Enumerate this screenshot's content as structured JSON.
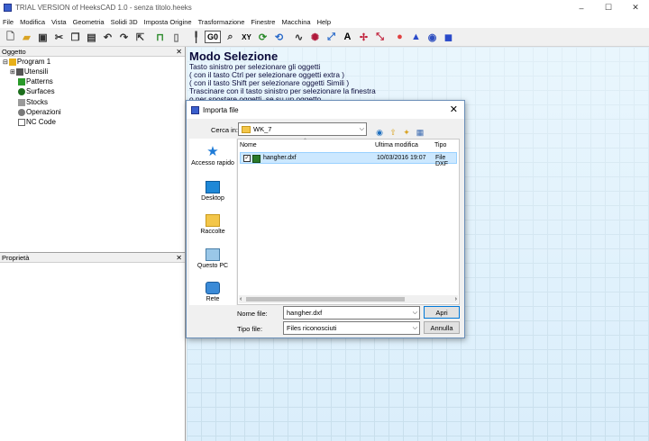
{
  "window": {
    "title": "TRIAL VERSION of HeeksCAD 1.0 - senza titolo.heeks",
    "minimize": "–",
    "maximize": "☐",
    "close": "✕"
  },
  "menu": [
    "File",
    "Modifica",
    "Vista",
    "Geometria",
    "Solidi 3D",
    "Imposta Origine",
    "Trasformazione",
    "Finestre",
    "Macchina",
    "Help"
  ],
  "toolbar": {
    "g0_label": "G0",
    "xy_label": "XY",
    "text_label": "A"
  },
  "object_panel": {
    "title": "Oggetto",
    "close": "✕",
    "tree": [
      "Program 1",
      "Utensili",
      "Patterns",
      "Surfaces",
      "Stocks",
      "Operazioni",
      "NC Code"
    ]
  },
  "properties_panel": {
    "title": "Proprietà",
    "close": "✕"
  },
  "canvas": {
    "mode_title": "Modo Selezione",
    "hints": [
      "Tasto sinistro per selezionare gli oggetti",
      "( con il tasto Ctrl per selezionare oggetti extra )",
      "( con il tasto Shift per selezionare oggetti Simili )",
      "Trascinare con il tasto sinistro per selezionare la finestra",
      "o per spostare oggetti, se su un oggetto."
    ]
  },
  "dialog": {
    "title": "Importa file",
    "close": "✕",
    "look_in_label": "Cerca in:",
    "look_in_value": "WK_7",
    "places": [
      "Accesso rapido",
      "Desktop",
      "Raccolte",
      "Questo PC",
      "Rete"
    ],
    "columns": [
      "Nome",
      "Ultima modifica",
      "Tipo"
    ],
    "files": [
      {
        "name": "hangher.dxf",
        "modified": "10/03/2016 19:07",
        "type": "File DXF",
        "checked": true
      }
    ],
    "file_name_label": "Nome file:",
    "file_name_value": "hangher.dxf",
    "file_type_label": "Tipo file:",
    "file_type_value": "Files riconosciuti",
    "open_button": "Apri",
    "cancel_button": "Annulla"
  }
}
